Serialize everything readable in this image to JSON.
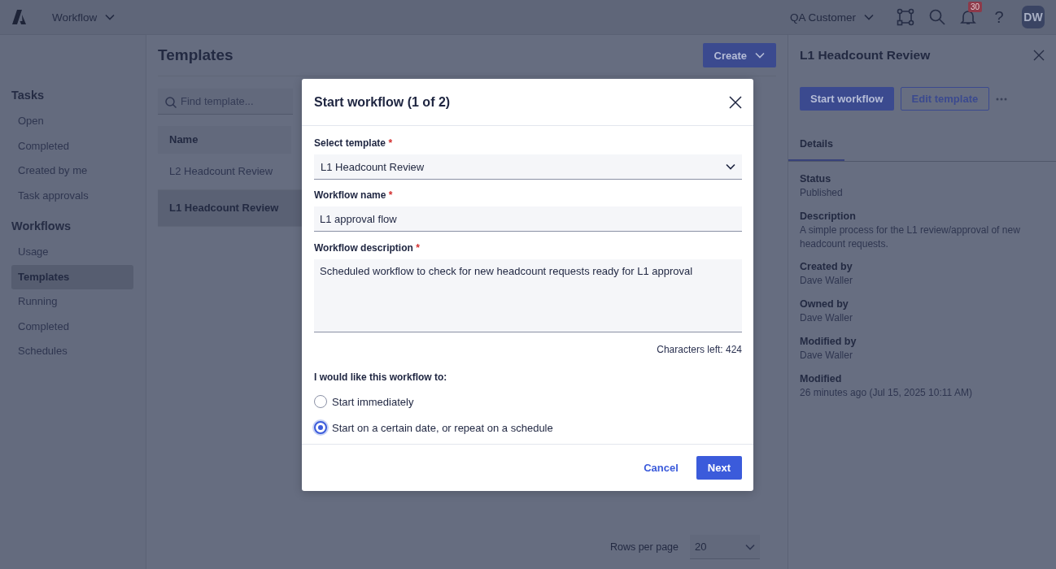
{
  "top_bar": {
    "app_menu": "Workflow",
    "account": "QA Customer",
    "notification_count": "30",
    "help": "?",
    "avatar_initials": "DW"
  },
  "sidebar": {
    "sections": [
      {
        "title": "Tasks",
        "items": [
          {
            "label": "Open",
            "selected": false
          },
          {
            "label": "Completed",
            "selected": false
          },
          {
            "label": "Created by me",
            "selected": false
          },
          {
            "label": "Task approvals",
            "selected": false
          }
        ]
      },
      {
        "title": "Workflows",
        "items": [
          {
            "label": "Usage",
            "selected": false
          },
          {
            "label": "Templates",
            "selected": true
          },
          {
            "label": "Running",
            "selected": false
          },
          {
            "label": "Completed",
            "selected": false
          },
          {
            "label": "Schedules",
            "selected": false
          }
        ]
      }
    ]
  },
  "main": {
    "title": "Templates",
    "create_button": "Create",
    "search": {
      "placeholder": "Find template..."
    },
    "table": {
      "columns": [
        "Name"
      ],
      "rows": [
        {
          "name": "L2 Headcount Review",
          "selected": false
        },
        {
          "name": "L1 Headcount Review",
          "selected": true
        }
      ]
    },
    "pagination": {
      "label": "Rows per page",
      "value": "20"
    }
  },
  "details_panel": {
    "title": "L1 Headcount Review",
    "primary_button": "Start workflow",
    "secondary_button": "Edit template",
    "tabs": [
      {
        "label": "Details",
        "selected": true
      }
    ],
    "fields": [
      {
        "label": "Status",
        "value": "Published"
      },
      {
        "label": "Description",
        "value": "A simple process for the L1 review/approval of new headcount requests."
      },
      {
        "label": "Created by",
        "value": "Dave Waller"
      },
      {
        "label": "Owned by",
        "value": "Dave Waller"
      },
      {
        "label": "Modified by",
        "value": "Dave Waller"
      },
      {
        "label": "Modified",
        "value": "26 minutes ago (Jul 15, 2025 10:11 AM)"
      }
    ]
  },
  "dialog": {
    "title": "Start workflow (1 of 2)",
    "select_template": {
      "label": "Select template",
      "required_mark": "*",
      "value": "L1 Headcount Review"
    },
    "workflow_name": {
      "label": "Workflow name",
      "required_mark": "*",
      "value": "L1 approval flow"
    },
    "description": {
      "label": "Workflow description",
      "required_mark": "*",
      "value": "Scheduled workflow to check for new headcount requests ready for L1 approval"
    },
    "characters_left": "Characters left: 424",
    "start_options": {
      "label": "I would like this workflow to:",
      "options": [
        {
          "label": "Start immediately",
          "selected": false
        },
        {
          "label": "Start on a certain date, or repeat on a schedule",
          "selected": true
        }
      ]
    },
    "cancel_button": "Cancel",
    "next_button": "Next"
  }
}
